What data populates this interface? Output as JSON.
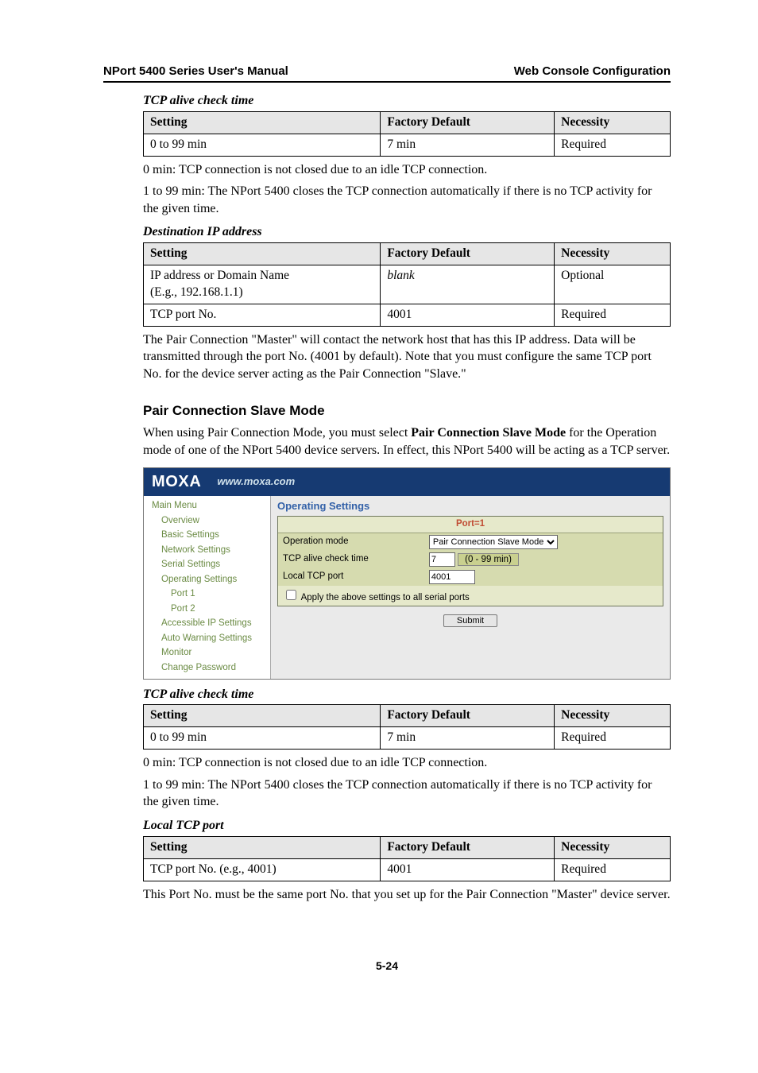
{
  "header": {
    "left": "NPort 5400 Series User's Manual",
    "right": "Web Console Configuration"
  },
  "tblcols": {
    "setting": "Setting",
    "default": "Factory Default",
    "necessity": "Necessity"
  },
  "sec1": {
    "title": "TCP alive check time",
    "row": {
      "setting": "0 to 99 min",
      "default": "7 min",
      "necessity": "Required"
    },
    "p1": "0 min: TCP connection is not closed due to an idle TCP connection.",
    "p2": "1 to 99 min: The NPort 5400 closes the TCP connection automatically if there is no TCP activity for the given time."
  },
  "sec2": {
    "title": "Destination IP address",
    "row1": {
      "setting_a": "IP address or Domain Name",
      "setting_b": "(E.g., 192.168.1.1)",
      "default": "blank",
      "necessity": "Optional"
    },
    "row2": {
      "setting": "TCP port No.",
      "default": "4001",
      "necessity": "Required"
    },
    "p": "The Pair Connection \"Master\" will contact the network host that has this IP address. Data will be transmitted through the port No. (4001 by default). Note that you must configure the same TCP port No. for the device server acting as the Pair Connection \"Slave.\""
  },
  "pair": {
    "heading": "Pair Connection Slave Mode",
    "intro_a": "When using Pair Connection Mode, you must select ",
    "intro_b": "Pair Connection Slave Mode",
    "intro_c": " for the Operation mode of one of the NPort 5400 device servers. In effect, this NPort 5400 will be acting as a TCP server."
  },
  "moxa": {
    "logo": "MOXA",
    "url": "www.moxa.com",
    "nav": [
      "Main Menu",
      "Overview",
      "Basic Settings",
      "Network Settings",
      "Serial Settings",
      "Operating Settings",
      "Port 1",
      "Port 2",
      "Accessible IP Settings",
      "Auto Warning Settings",
      "Monitor",
      "Change Password"
    ],
    "title": "Operating Settings",
    "port": "Port=1",
    "fields": {
      "opmode_lbl": "Operation mode",
      "opmode_val": "Pair Connection Slave Mode",
      "alive_lbl": "TCP alive check time",
      "alive_val": "7",
      "alive_suffix": "(0 - 99 min)",
      "localtcp_lbl": "Local TCP port",
      "localtcp_val": "4001",
      "apply": "Apply the above settings to all serial ports",
      "submit": "Submit"
    }
  },
  "sec3": {
    "title": "TCP alive check time",
    "row": {
      "setting": "0 to 99 min",
      "default": "7 min",
      "necessity": "Required"
    },
    "p1": "0 min: TCP connection is not closed due to an idle TCP connection.",
    "p2": "1 to 99 min: The NPort 5400 closes the TCP connection automatically if there is no TCP activity for the given time."
  },
  "sec4": {
    "title": "Local TCP port",
    "row": {
      "setting": "TCP port No. (e.g., 4001)",
      "default": "4001",
      "necessity": "Required"
    },
    "p": "This Port No. must be the same port No. that you set up for the Pair Connection \"Master\" device server."
  },
  "pagenum": "5-24"
}
